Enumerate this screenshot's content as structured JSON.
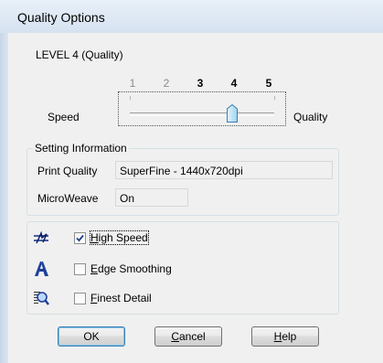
{
  "window": {
    "title": "Quality Options"
  },
  "level_label": "LEVEL 4 (Quality)",
  "slider": {
    "ticks": [
      "1",
      "2",
      "3",
      "4",
      "5"
    ],
    "selected_index": 3,
    "left_label": "Speed",
    "right_label": "Quality"
  },
  "setting_info": {
    "title": "Setting Information",
    "print_quality_label": "Print Quality",
    "print_quality_value": "SuperFine - 1440x720dpi",
    "microweave_label": "MicroWeave",
    "microweave_value": "On"
  },
  "options": [
    {
      "label_mnemonic": "H",
      "label_rest": "igh Speed",
      "checked": true,
      "icon": "high-speed-icon"
    },
    {
      "label_mnemonic": "E",
      "label_rest": "dge Smoothing",
      "checked": false,
      "icon": "edge-smoothing-icon"
    },
    {
      "label_mnemonic": "F",
      "label_rest": "inest Detail",
      "checked": false,
      "icon": "finest-detail-icon"
    }
  ],
  "buttons": {
    "ok": "OK",
    "cancel_mnemonic": "C",
    "cancel_rest": "ancel",
    "help_mnemonic": "H",
    "help_rest": "elp"
  }
}
